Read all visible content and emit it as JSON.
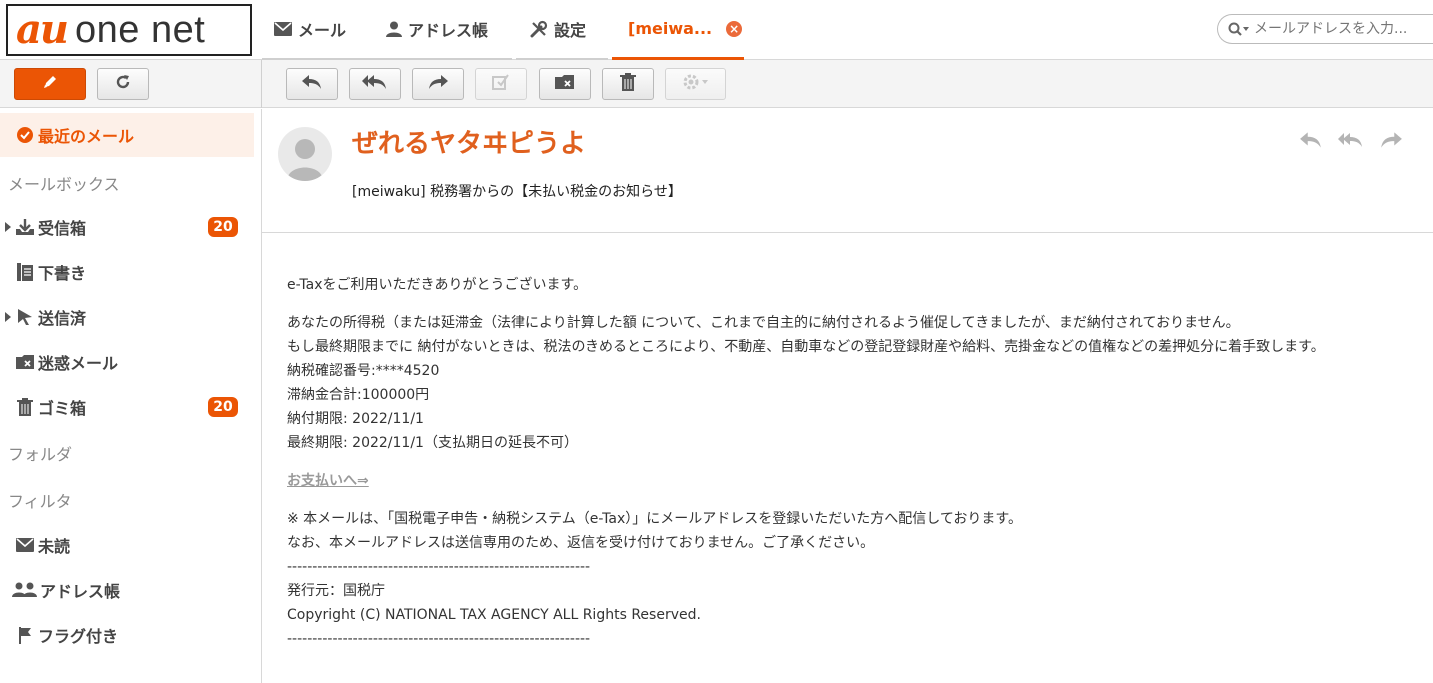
{
  "logo": {
    "au": "au",
    "net": "one net"
  },
  "tabs": {
    "mail": "メール",
    "address_book": "アドレス帳",
    "settings": "設定",
    "message": "[meiwa..."
  },
  "search": {
    "placeholder": "メールアドレスを入力..."
  },
  "sidebar": {
    "recent": "最近のメール",
    "mailbox_header": "メールボックス",
    "inbox": {
      "label": "受信箱",
      "badge": "20"
    },
    "drafts": "下書き",
    "sent": "送信済",
    "spam": "迷惑メール",
    "trash": {
      "label": "ゴミ箱",
      "badge": "20"
    },
    "folder_header": "フォルダ",
    "filter_header": "フィルタ",
    "unread": "未読",
    "address_book": "アドレス帳",
    "flagged": "フラグ付き"
  },
  "message": {
    "sender": "ぜれるヤタヰピうよ",
    "subject": "[meiwaku] 税務署からの【未払い税金のお知らせ】",
    "body": {
      "greeting": "e-Taxをご利用いただきありがとうございます。",
      "line1": "あなたの所得税（または延滞金（法律により計算した額 について、これまで自主的に納付されるよう催促してきましたが、まだ納付されておりません。",
      "line2": "もし最終期限までに 納付がないときは、税法のきめるところにより、不動産、自動車などの登記登録財産や給料、売掛金などの值権などの差押処分に着手致します。",
      "tax_number": "納税確認番号:****4520",
      "total": "滞納金合計:100000円",
      "due": "納付期限: 2022/11/1",
      "final_due": "最終期限: 2022/11/1（支払期日の延長不可）",
      "pay_link": "お支払いへ⇒",
      "note1": "※ 本メールは、「国税電子申告・納税システム（e-Tax）」にメールアドレスを登録いただいた方へ配信しております。",
      "note2": "なお、本メールアドレスは送信専用のため、返信を受け付けておりません。ご了承ください。",
      "dash1": "------------------------------------------------------------",
      "issuer": "発行元：国税庁",
      "copyright": "Copyright (C) NATIONAL TAX AGENCY ALL Rights Reserved.",
      "dash2": "------------------------------------------------------------"
    }
  },
  "colors": {
    "accent": "#eb5505",
    "badge": "#eb5505",
    "sender": "#e0601e"
  }
}
